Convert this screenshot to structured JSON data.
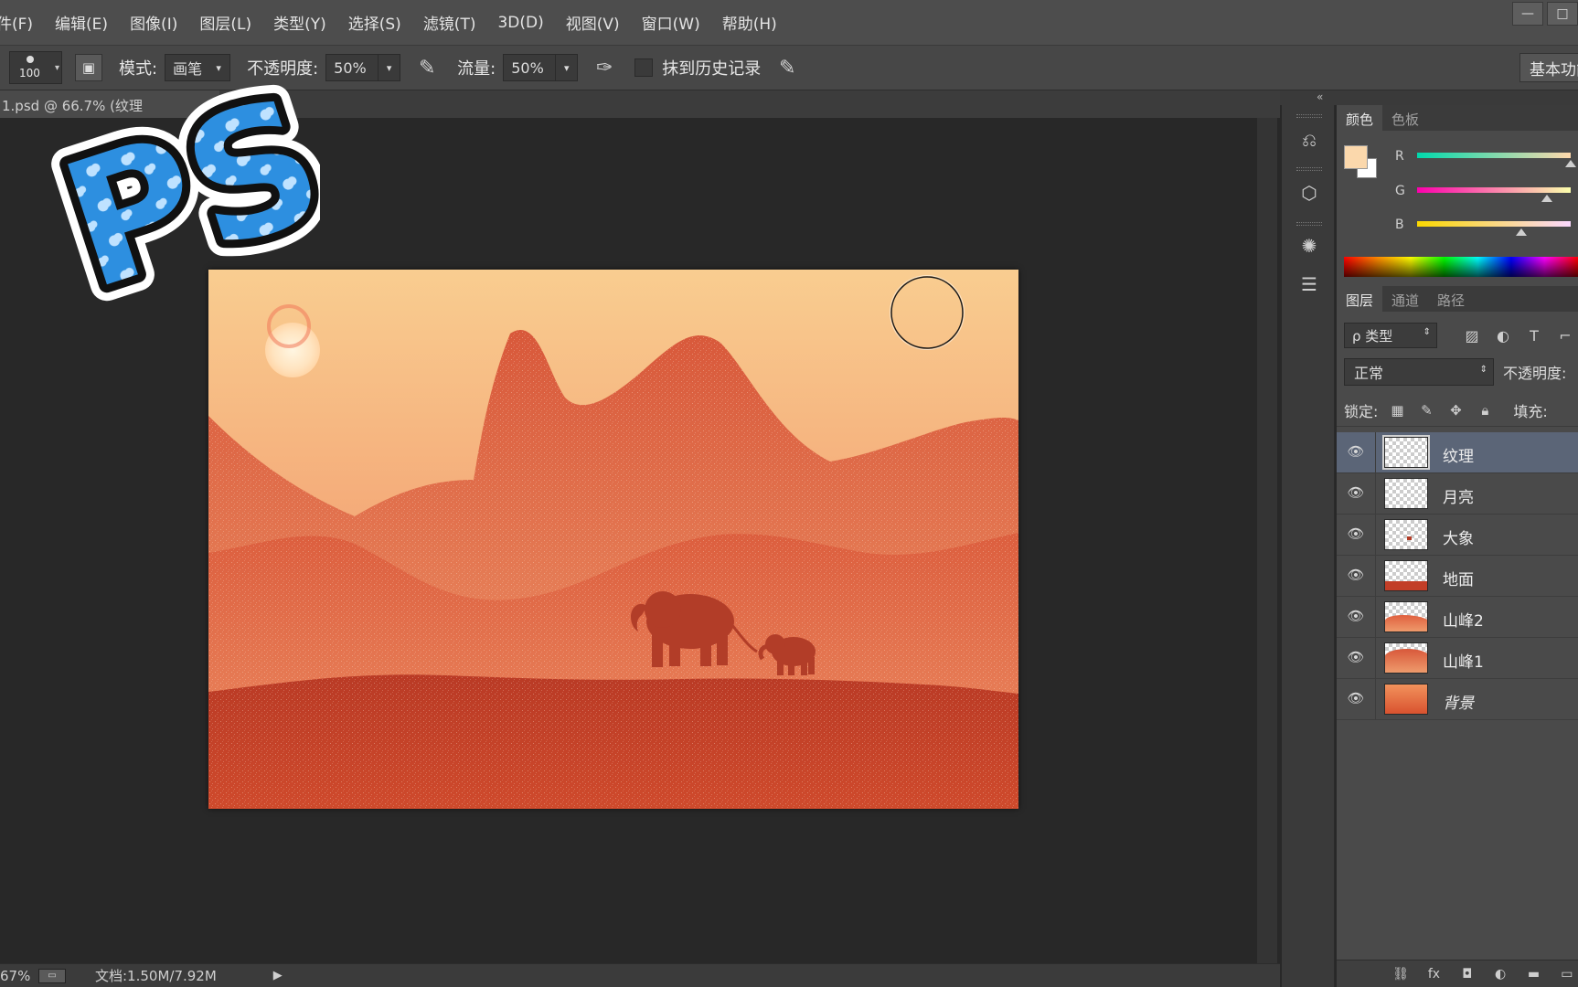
{
  "menu": [
    "件(F)",
    "编辑(E)",
    "图像(I)",
    "图层(L)",
    "类型(Y)",
    "选择(S)",
    "滤镜(T)",
    "3D(D)",
    "视图(V)",
    "窗口(W)",
    "帮助(H)"
  ],
  "window_controls": {
    "minimize": "—",
    "restore": "□"
  },
  "options_bar": {
    "brush_size": "100",
    "mode_label": "模式:",
    "mode_value": "画笔",
    "opacity_label": "不透明度:",
    "opacity_value": "50%",
    "flow_label": "流量:",
    "flow_value": "50%",
    "erase_history_label": "抹到历史记录",
    "workspace": "基本功能"
  },
  "document": {
    "tab_title": "1.psd @ 66.7% (纹理"
  },
  "status_bar": {
    "zoom": "67%",
    "doc_size": "文档:1.50M/7.92M",
    "arrow": "▶"
  },
  "logo_text": "PS",
  "color_panel": {
    "tabs": [
      "颜色",
      "色板"
    ],
    "foreground": "#fbd8ac",
    "channels": [
      {
        "label": "R",
        "value": 251
      },
      {
        "label": "G",
        "value": 216
      },
      {
        "label": "B",
        "value": 172
      }
    ]
  },
  "layers_panel": {
    "tabs": [
      "图层",
      "通道",
      "路径"
    ],
    "kind_filter": "ρ 类型",
    "blend_mode": "正常",
    "opacity_label": "不透明度:",
    "lock_label": "锁定:",
    "fill_label": "填充:",
    "layers": [
      {
        "name": "纹理",
        "selected": true
      },
      {
        "name": "月亮",
        "selected": false
      },
      {
        "name": "大象",
        "selected": false
      },
      {
        "name": "地面",
        "selected": false
      },
      {
        "name": "山峰2",
        "selected": false
      },
      {
        "name": "山峰1",
        "selected": false
      },
      {
        "name": "背景",
        "selected": false
      }
    ]
  },
  "colors": {
    "sky_top": "#f8c98e",
    "sky_bottom": "#f19a66",
    "mountain_back": "#e57149",
    "mountain_front": "#d9553a",
    "ground": "#c23e27",
    "moon": "#fff1d6"
  }
}
